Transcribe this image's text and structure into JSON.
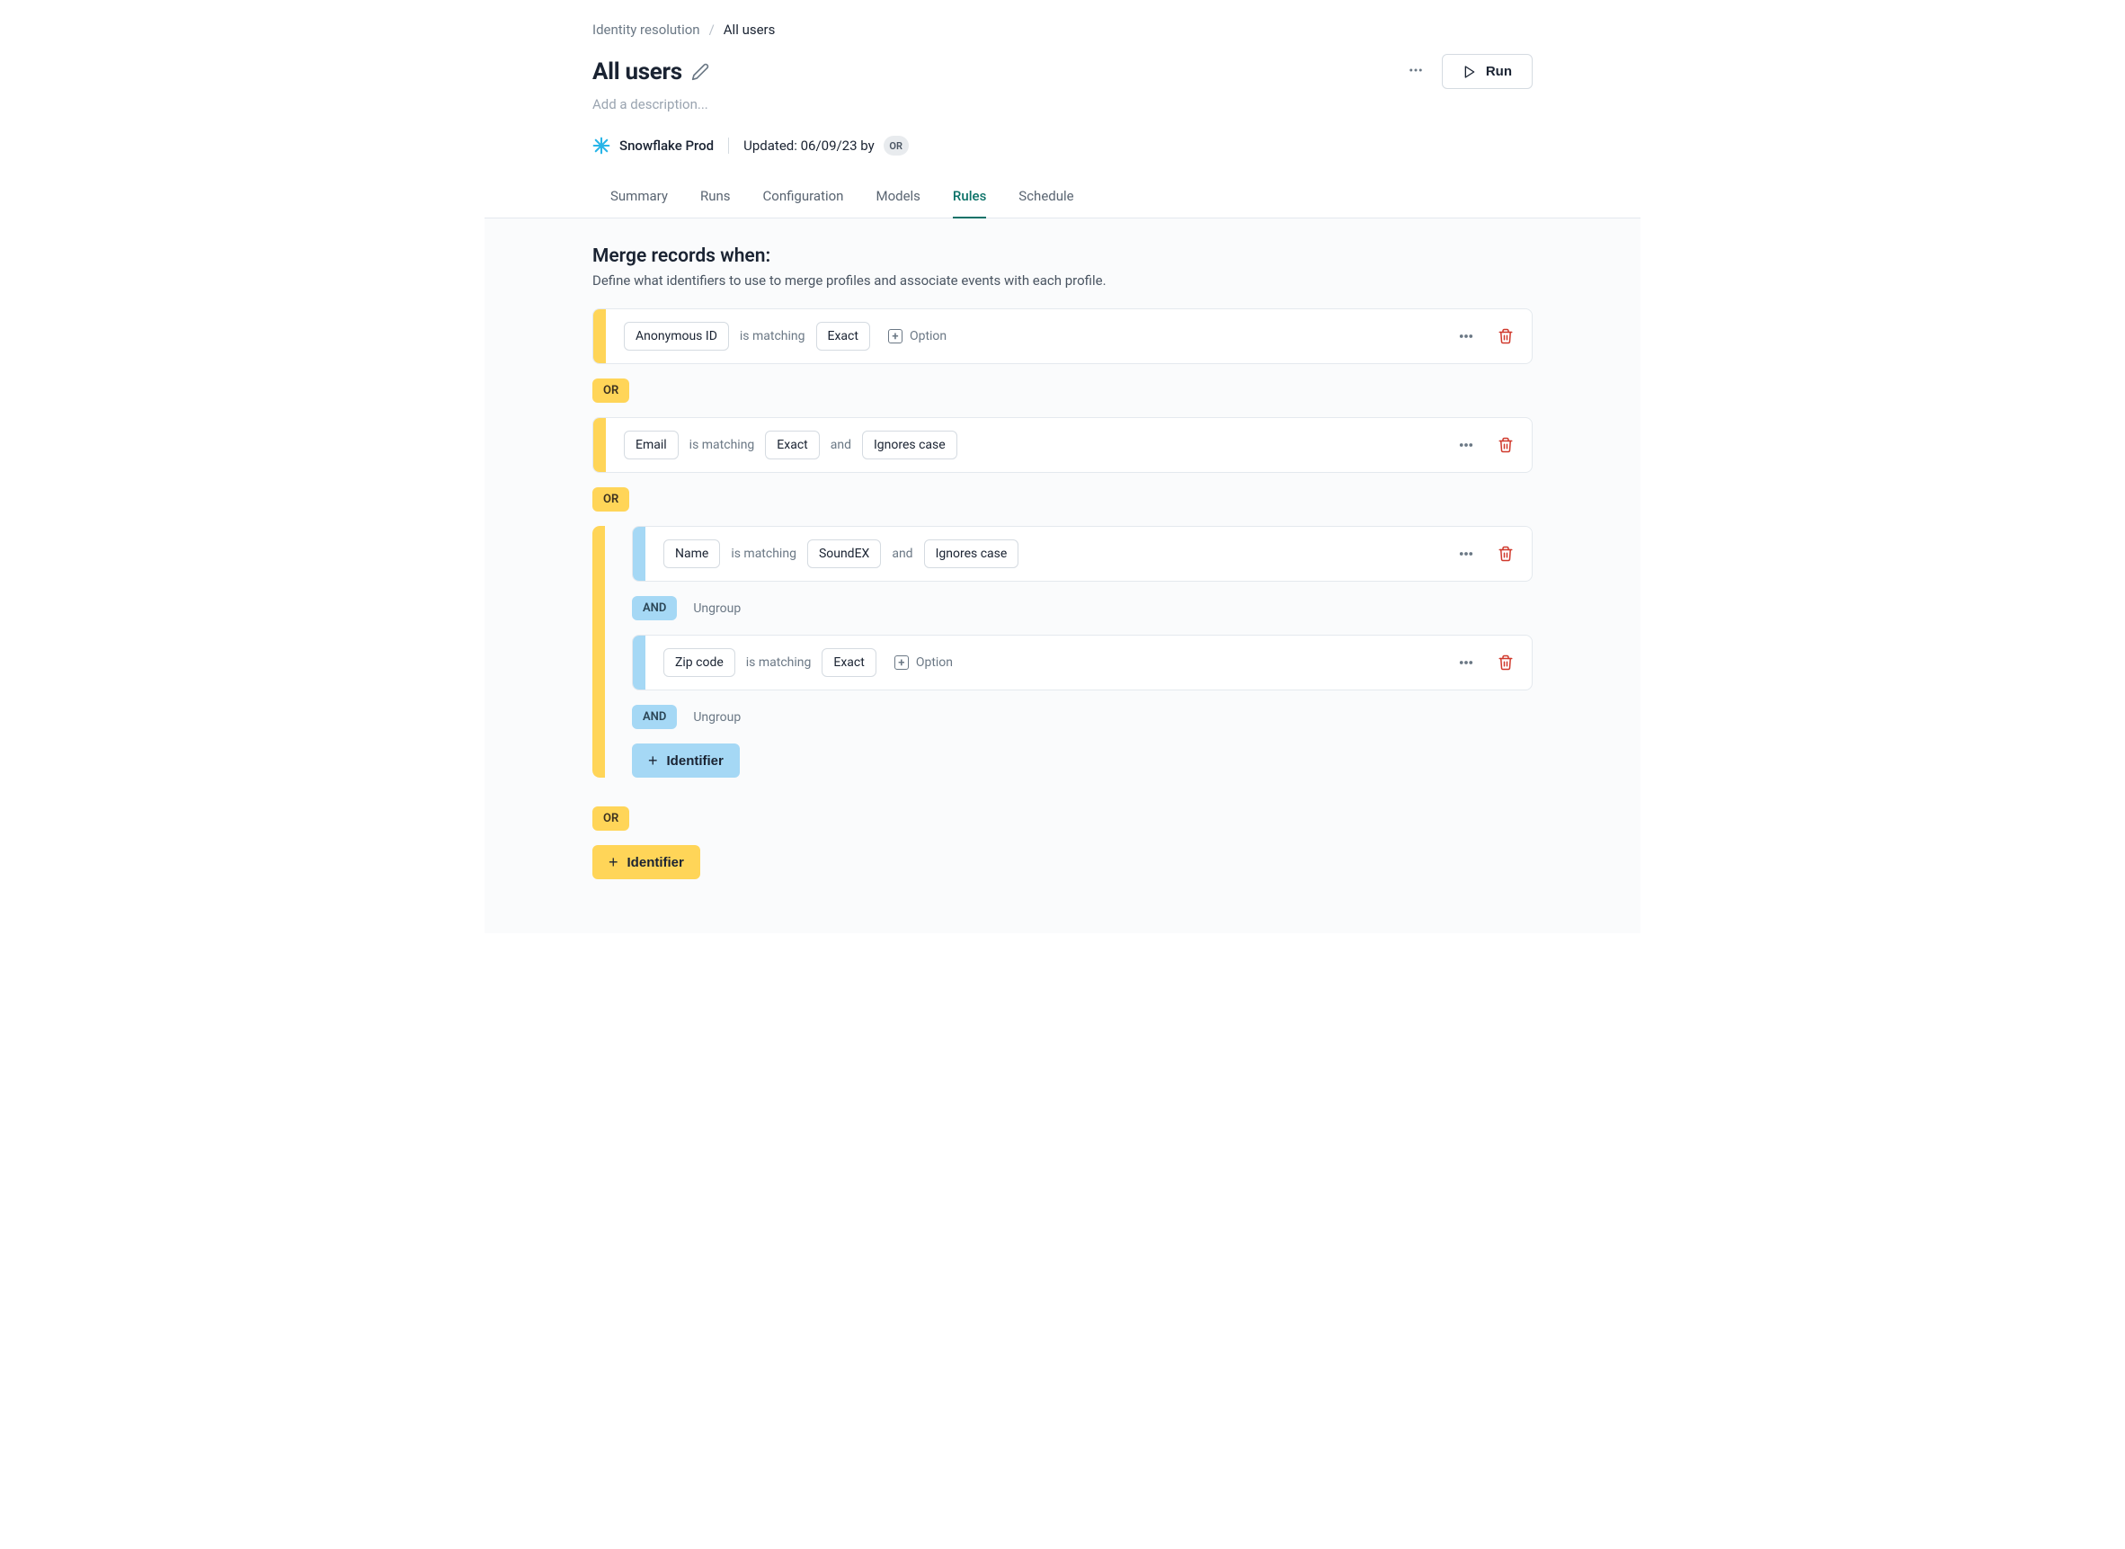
{
  "breadcrumb": {
    "parent": "Identity resolution",
    "current": "All users"
  },
  "header": {
    "title": "All users",
    "description_placeholder": "Add a description...",
    "source": "Snowflake Prod",
    "updated_label": "Updated: 06/09/23 by",
    "updated_by_initials": "OR",
    "run_label": "Run"
  },
  "tabs": [
    {
      "label": "Summary",
      "active": false
    },
    {
      "label": "Runs",
      "active": false
    },
    {
      "label": "Configuration",
      "active": false
    },
    {
      "label": "Models",
      "active": false
    },
    {
      "label": "Rules",
      "active": true
    },
    {
      "label": "Schedule",
      "active": false
    }
  ],
  "section": {
    "title": "Merge records when:",
    "subtitle": "Define what identifiers to use to merge profiles and associate events with each profile."
  },
  "labels": {
    "is_matching": "is matching",
    "and": "and",
    "option": "Option",
    "or": "OR",
    "and_pill": "AND",
    "ungroup": "Ungroup",
    "identifier": "Identifier"
  },
  "rules": {
    "r1": {
      "identifier": "Anonymous ID",
      "match": "Exact"
    },
    "r2": {
      "identifier": "Email",
      "match": "Exact",
      "second": "Ignores case"
    },
    "r3": {
      "identifier": "Name",
      "match": "SoundEX",
      "second": "Ignores case"
    },
    "r4": {
      "identifier": "Zip code",
      "match": "Exact"
    }
  }
}
